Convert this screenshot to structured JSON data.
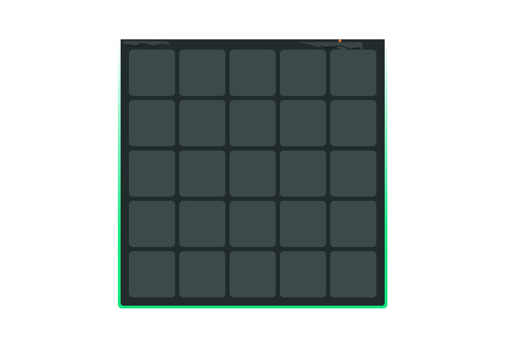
{
  "game": {
    "grid_rows": 5,
    "grid_cols": 5,
    "tiles": [
      {
        "row": 1,
        "col": 1,
        "state": "hidden"
      },
      {
        "row": 1,
        "col": 2,
        "state": "hidden"
      },
      {
        "row": 1,
        "col": 3,
        "state": "hidden"
      },
      {
        "row": 1,
        "col": 4,
        "state": "hidden"
      },
      {
        "row": 1,
        "col": 5,
        "state": "hidden"
      },
      {
        "row": 2,
        "col": 1,
        "state": "hidden"
      },
      {
        "row": 2,
        "col": 2,
        "state": "hidden"
      },
      {
        "row": 2,
        "col": 3,
        "state": "hidden"
      },
      {
        "row": 2,
        "col": 4,
        "state": "hidden"
      },
      {
        "row": 2,
        "col": 5,
        "state": "hidden"
      },
      {
        "row": 3,
        "col": 1,
        "state": "hidden"
      },
      {
        "row": 3,
        "col": 2,
        "state": "hidden"
      },
      {
        "row": 3,
        "col": 3,
        "state": "hidden"
      },
      {
        "row": 3,
        "col": 4,
        "state": "hidden"
      },
      {
        "row": 3,
        "col": 5,
        "state": "hidden"
      },
      {
        "row": 4,
        "col": 1,
        "state": "hidden"
      },
      {
        "row": 4,
        "col": 2,
        "state": "hidden"
      },
      {
        "row": 4,
        "col": 3,
        "state": "hidden"
      },
      {
        "row": 4,
        "col": 4,
        "state": "hidden"
      },
      {
        "row": 4,
        "col": 5,
        "state": "hidden"
      },
      {
        "row": 5,
        "col": 1,
        "state": "hidden"
      },
      {
        "row": 5,
        "col": 2,
        "state": "hidden"
      },
      {
        "row": 5,
        "col": 3,
        "state": "hidden"
      },
      {
        "row": 5,
        "col": 4,
        "state": "hidden"
      },
      {
        "row": 5,
        "col": 5,
        "state": "hidden"
      }
    ]
  },
  "colors": {
    "board_background": "#222b2b",
    "tile": "#3c4a49",
    "frame_glow": "#1ee98a",
    "page_background": "#ffffff"
  },
  "icons": {
    "board_decoration": "cracked-edge-ornament-icon"
  }
}
